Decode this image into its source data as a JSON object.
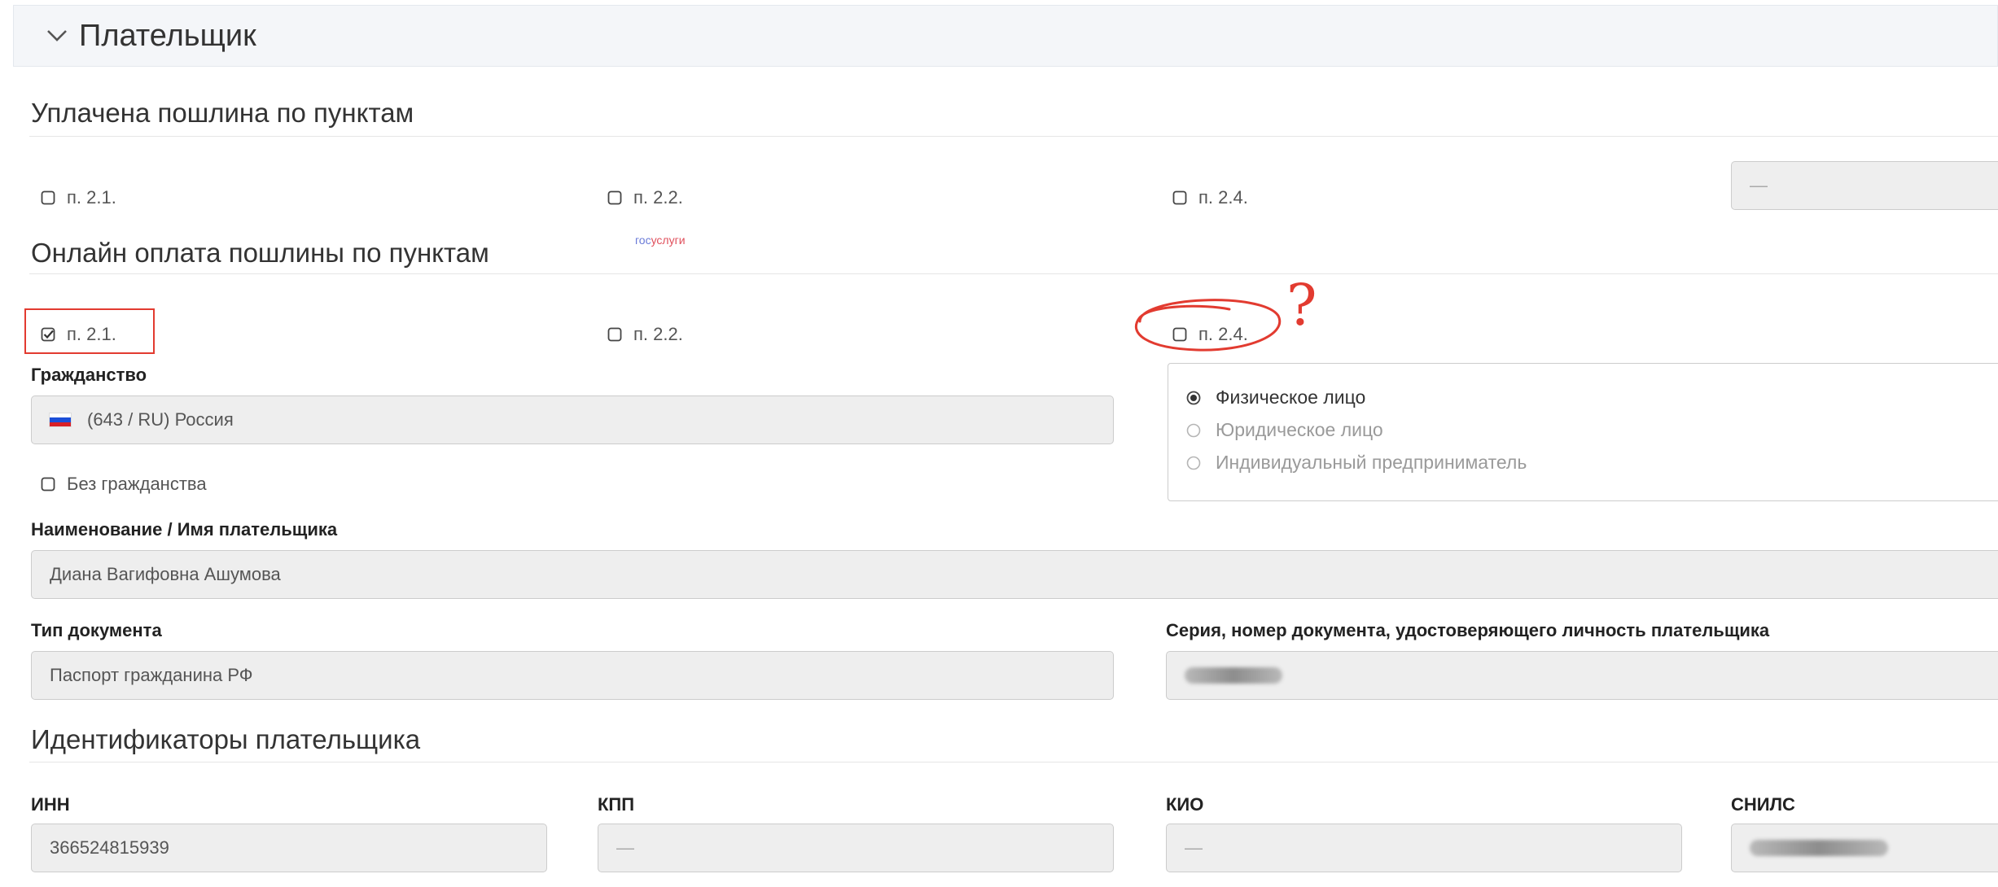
{
  "panel": {
    "title": "Плательщик"
  },
  "paid": {
    "title": "Уплачена пошлина по пунктам",
    "items": [
      {
        "label": "п. 2.1.",
        "checked": false
      },
      {
        "label": "п. 2.2.",
        "checked": false
      },
      {
        "label": "п. 2.4.",
        "checked": false
      }
    ],
    "select_value": "—"
  },
  "online": {
    "title": "Онлайн оплата пошлины по пунктам",
    "badge": {
      "part1": "гос",
      "part2": "услуги"
    },
    "items": [
      {
        "label": "п. 2.1.",
        "checked": true
      },
      {
        "label": "п. 2.2.",
        "checked": false
      },
      {
        "label": "п. 2.4.",
        "checked": false
      }
    ]
  },
  "annotation": {
    "question_mark": "?",
    "color": "#e23b30"
  },
  "citizenship": {
    "label": "Гражданство",
    "value": "(643 / RU)  Россия",
    "flag_icon": "russia-flag-icon",
    "no_citizenship_label": "Без гражданства"
  },
  "payer_type": {
    "options": [
      {
        "label": "Физическое лицо",
        "selected": true
      },
      {
        "label": "Юридическое лицо",
        "selected": false
      },
      {
        "label": "Индивидуальный предприниматель",
        "selected": false
      }
    ]
  },
  "name": {
    "label": "Наименование / Имя плательщика",
    "value": "Диана Вагифовна Ашумова"
  },
  "document": {
    "type_label": "Тип документа",
    "type_value": "Паспорт гражданина РФ",
    "number_label": "Серия, номер документа, удостоверяющего личность плательщика"
  },
  "identifiers": {
    "title": "Идентификаторы плательщика",
    "inn": {
      "label": "ИНН",
      "value": "366524815939"
    },
    "kpp": {
      "label": "КПП",
      "value": "—"
    },
    "kio": {
      "label": "КИО",
      "value": "—"
    },
    "snils": {
      "label": "СНИЛС"
    }
  },
  "colors": {
    "accent_red": "#e23b30",
    "input_bg": "#eeeeee",
    "header_bg": "#f4f6f9"
  }
}
